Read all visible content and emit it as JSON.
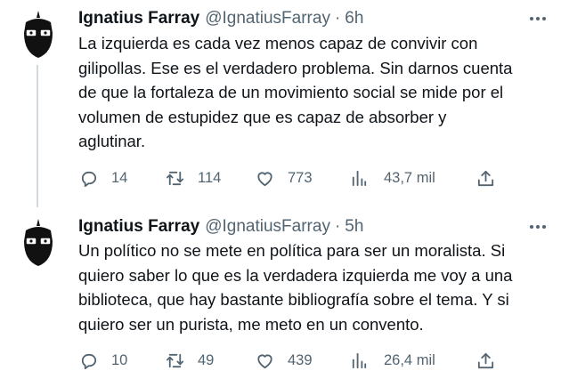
{
  "tweets": [
    {
      "name": "Ignatius Farray",
      "handle": "@IgnatiusFarray",
      "separator": "·",
      "time": "6h",
      "text": "La izquierda es cada vez menos capaz de convivir con\ngilipollas. Ese es el verdadero problema. Sin darnos cuenta\nde que la fortaleza de un movimiento social se mide por el\nvolumen de estupidez que es capaz de absorber y\naglutinar.",
      "replies": "14",
      "retweets": "114",
      "likes": "773",
      "views": "43,7 mil",
      "icons": [
        "reply-icon",
        "retweet-icon",
        "like-icon",
        "views-icon",
        "share-icon",
        "more-icon"
      ]
    },
    {
      "name": "Ignatius Farray",
      "handle": "@IgnatiusFarray",
      "separator": "·",
      "time": "5h",
      "text": "Un político no se mete en política para ser un moralista. Si\nquiero saber lo que es la verdadera izquierda me voy a una\nbiblioteca, que hay bastante bibliografía sobre el tema. Y si\nquiero ser un purista, me meto en un convento.",
      "replies": "10",
      "retweets": "49",
      "likes": "439",
      "views": "26,4 mil",
      "icons": [
        "reply-icon",
        "retweet-icon",
        "like-icon",
        "views-icon",
        "share-icon",
        "more-icon"
      ]
    }
  ],
  "colors": {
    "text": "#0f1419",
    "secondary": "#536471",
    "thread_line": "#cfd9de",
    "background": "#ffffff"
  }
}
